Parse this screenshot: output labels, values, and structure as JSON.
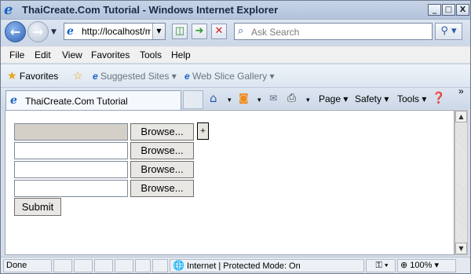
{
  "window": {
    "title": "ThaiCreate.Com Tutorial - Windows Internet Explorer",
    "minimize": "_",
    "maximize": "□",
    "close": "X"
  },
  "address": {
    "url": "http://localhost/my",
    "search_placeholder": "Ask Search"
  },
  "menu": [
    "File",
    "Edit",
    "View",
    "Favorites",
    "Tools",
    "Help"
  ],
  "favorites_bar": {
    "favorites_label": "Favorites",
    "suggested_sites": "Suggested Sites ▾",
    "web_slice_gallery": "Web Slice Gallery ▾"
  },
  "tab": {
    "title": "ThaiCreate.Com Tutorial"
  },
  "commands": {
    "page": "Page ▾",
    "safety": "Safety ▾",
    "tools": "Tools ▾",
    "more": "»"
  },
  "form": {
    "browse_label": "Browse...",
    "submit_label": "Submit",
    "file_inputs": [
      {
        "value": "",
        "disabled": true
      },
      {
        "value": "",
        "disabled": false
      },
      {
        "value": "",
        "disabled": false
      },
      {
        "value": "",
        "disabled": false
      }
    ]
  },
  "status": {
    "text": "Done",
    "zone": "Internet | Protected Mode: On",
    "zoom": "100%"
  },
  "icons": {
    "ie_logo": "ie-logo-icon",
    "back": "back-arrow-icon",
    "forward": "forward-arrow-icon",
    "refresh": "refresh-icon",
    "stop": "stop-icon",
    "home": "home-icon",
    "feeds": "rss-icon",
    "mail": "mail-icon",
    "print": "print-icon",
    "help": "help-icon"
  }
}
